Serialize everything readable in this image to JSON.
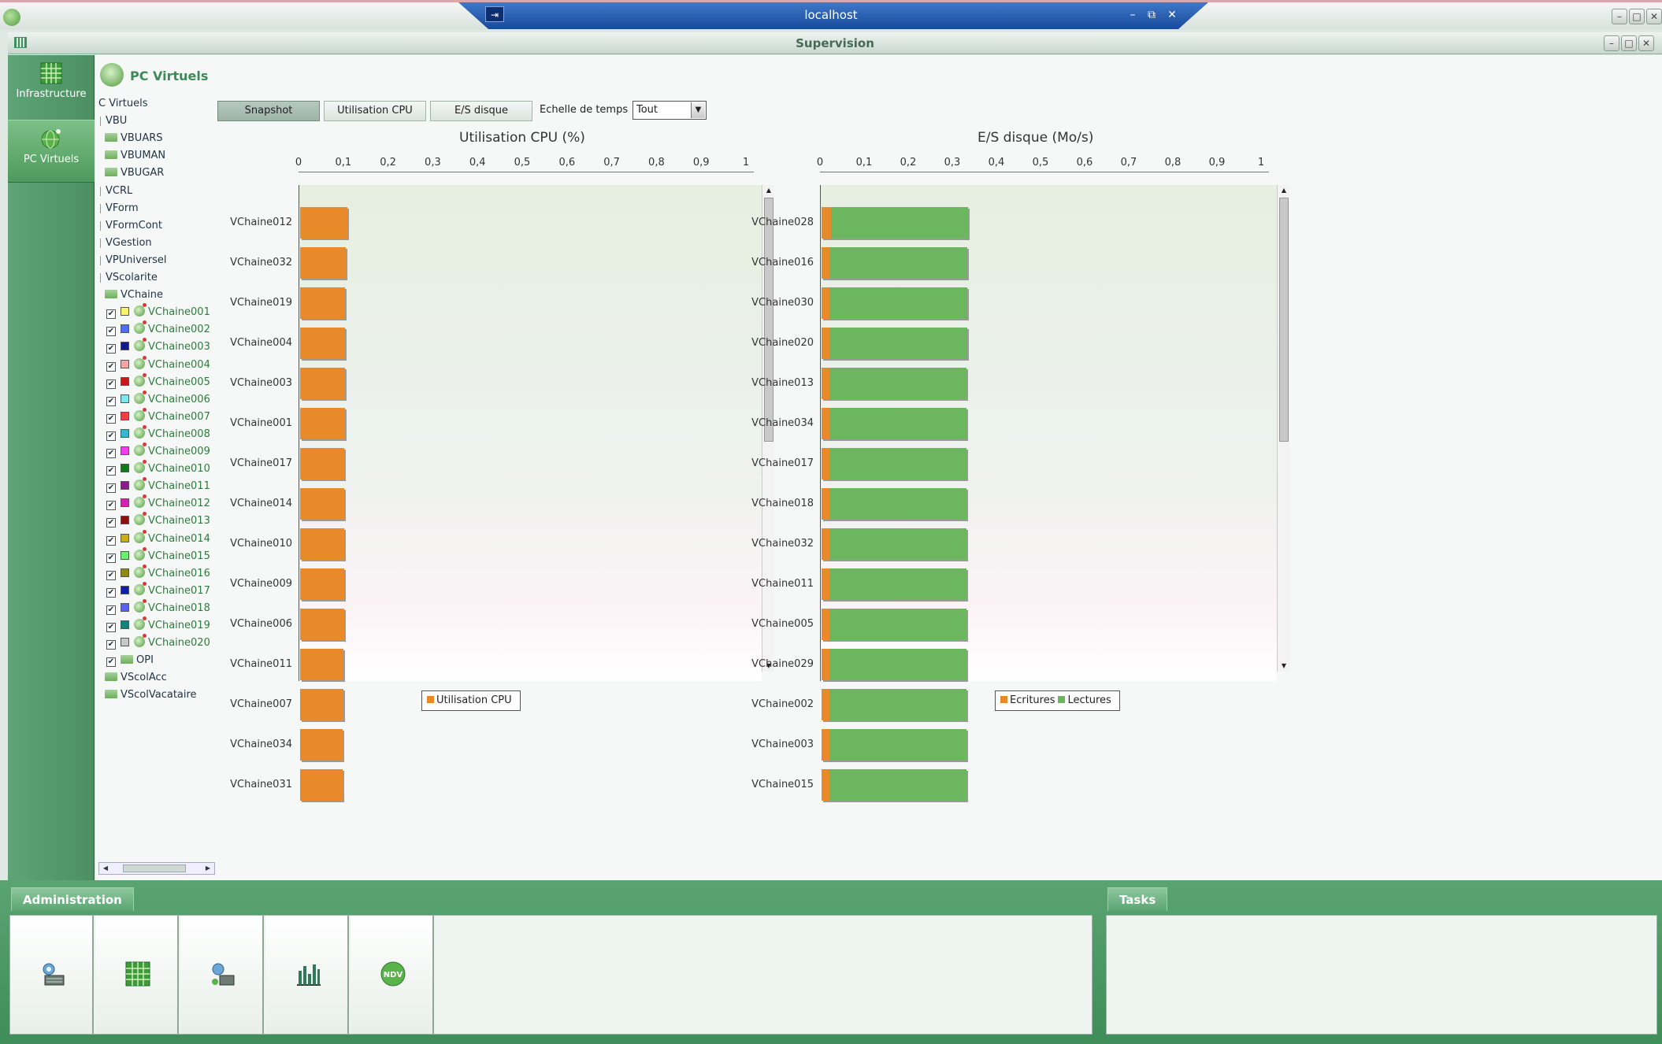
{
  "rdp": {
    "title": "localhost",
    "pin": "⇥",
    "min": "–",
    "restore": "⧉",
    "close": "✕"
  },
  "window": {
    "title": "Supervision",
    "min": "–",
    "max": "□",
    "close": "✕"
  },
  "nav": [
    {
      "label": "Infrastructure",
      "icon": "grid-icon"
    },
    {
      "label": "PC Virtuels",
      "icon": "globe-icon",
      "selected": true
    }
  ],
  "page": {
    "title": "PC Virtuels"
  },
  "tree": {
    "rows": [
      {
        "label": "C Virtuels",
        "kind": "text"
      },
      {
        "label": "VBU",
        "kind": "text"
      },
      {
        "label": "VBUARS",
        "kind": "folder"
      },
      {
        "label": "VBUMAN",
        "kind": "folder"
      },
      {
        "label": "VBUGAR",
        "kind": "folder"
      },
      {
        "label": "VCRL",
        "kind": "text"
      },
      {
        "label": "VForm",
        "kind": "text"
      },
      {
        "label": "VFormCont",
        "kind": "text"
      },
      {
        "label": "VGestion",
        "kind": "text"
      },
      {
        "label": "VPUniversel",
        "kind": "text"
      },
      {
        "label": "VScolarite",
        "kind": "text"
      },
      {
        "label": "VChaine",
        "kind": "folder"
      },
      {
        "label": "VChaine001",
        "kind": "vm",
        "color": "#f7f36a"
      },
      {
        "label": "VChaine002",
        "kind": "vm",
        "color": "#4f6df0"
      },
      {
        "label": "VChaine003",
        "kind": "vm",
        "color": "#101a8c"
      },
      {
        "label": "VChaine004",
        "kind": "vm",
        "color": "#f2a7a7"
      },
      {
        "label": "VChaine005",
        "kind": "vm",
        "color": "#c81a1a"
      },
      {
        "label": "VChaine006",
        "kind": "vm",
        "color": "#7fe8ef"
      },
      {
        "label": "VChaine007",
        "kind": "vm",
        "color": "#ee4040"
      },
      {
        "label": "VChaine008",
        "kind": "vm",
        "color": "#2fb9d2"
      },
      {
        "label": "VChaine009",
        "kind": "vm",
        "color": "#f040ee"
      },
      {
        "label": "VChaine010",
        "kind": "vm",
        "color": "#107a1a"
      },
      {
        "label": "VChaine011",
        "kind": "vm",
        "color": "#8a1a8c"
      },
      {
        "label": "VChaine012",
        "kind": "vm",
        "color": "#d81fb2"
      },
      {
        "label": "VChaine013",
        "kind": "vm",
        "color": "#8c1010"
      },
      {
        "label": "VChaine014",
        "kind": "vm",
        "color": "#c9b016"
      },
      {
        "label": "VChaine015",
        "kind": "vm",
        "color": "#6ef06e"
      },
      {
        "label": "VChaine016",
        "kind": "vm",
        "color": "#8c8a10"
      },
      {
        "label": "VChaine017",
        "kind": "vm",
        "color": "#0e1fa8"
      },
      {
        "label": "VChaine018",
        "kind": "vm",
        "color": "#5a5ff0"
      },
      {
        "label": "VChaine019",
        "kind": "vm",
        "color": "#15827f"
      },
      {
        "label": "VChaine020",
        "kind": "vm",
        "color": "#c8c8c8"
      },
      {
        "label": "OPI",
        "kind": "checkfolder"
      },
      {
        "label": "VScolAcc",
        "kind": "folder"
      },
      {
        "label": "VScolVacataire",
        "kind": "folder"
      }
    ]
  },
  "toolbar": {
    "buttons": [
      "Snapshot",
      "Utilisation CPU",
      "E/S disque"
    ],
    "active": "Snapshot",
    "echelle_label": "Echelle de temps",
    "echelle_value": "Tout"
  },
  "chart_data": [
    {
      "type": "bar",
      "orientation": "horizontal",
      "title": "Utilisation CPU (%)",
      "xlim": [
        0,
        1
      ],
      "ticks": [
        "0",
        "0,1",
        "0,2",
        "0,3",
        "0,4",
        "0,5",
        "0,6",
        "0,7",
        "0,8",
        "0,9",
        "1"
      ],
      "categories": [
        "VChaine012",
        "VChaine032",
        "VChaine019",
        "VChaine004",
        "VChaine003",
        "VChaine001",
        "VChaine017",
        "VChaine014",
        "VChaine010",
        "VChaine009",
        "VChaine006",
        "VChaine011",
        "VChaine007",
        "VChaine034",
        "VChaine031"
      ],
      "series": [
        {
          "name": "Utilisation CPU",
          "color": "#e8892a",
          "values": [
            0.106,
            0.102,
            0.1,
            0.1,
            0.1,
            0.1,
            0.099,
            0.099,
            0.098,
            0.098,
            0.098,
            0.097,
            0.096,
            0.095,
            0.095
          ]
        }
      ],
      "legend": [
        "Utilisation CPU"
      ],
      "legend_position": "bottom"
    },
    {
      "type": "bar",
      "orientation": "horizontal",
      "stacked": true,
      "title": "E/S disque (Mo/s)",
      "xlim": [
        0,
        1
      ],
      "ticks": [
        "0",
        "0,1",
        "0,2",
        "0,3",
        "0,4",
        "0,5",
        "0,6",
        "0,7",
        "0,8",
        "0,9",
        "1"
      ],
      "categories": [
        "VChaine028",
        "VChaine016",
        "VChaine030",
        "VChaine020",
        "VChaine013",
        "VChaine034",
        "VChaine017",
        "VChaine018",
        "VChaine032",
        "VChaine011",
        "VChaine005",
        "VChaine029",
        "VChaine002",
        "VChaine003",
        "VChaine015"
      ],
      "series": [
        {
          "name": "Ecritures",
          "color": "#e8892a",
          "values": [
            0.021,
            0.018,
            0.018,
            0.018,
            0.018,
            0.018,
            0.018,
            0.018,
            0.018,
            0.018,
            0.018,
            0.018,
            0.018,
            0.018,
            0.018
          ]
        },
        {
          "name": "Lectures",
          "color": "#6bb65e",
          "values": [
            0.311,
            0.312,
            0.312,
            0.312,
            0.311,
            0.311,
            0.311,
            0.311,
            0.311,
            0.311,
            0.311,
            0.311,
            0.311,
            0.31,
            0.31
          ]
        }
      ],
      "legend": [
        "Ecritures",
        "Lectures"
      ],
      "legend_position": "bottom"
    }
  ],
  "bottom": {
    "admin_tab": "Administration",
    "tasks_tab": "Tasks",
    "tiles": [
      "users-icon",
      "grid-icon",
      "network-icon",
      "chart-icon",
      "ndv-icon"
    ],
    "ndv_text": "NDV"
  }
}
